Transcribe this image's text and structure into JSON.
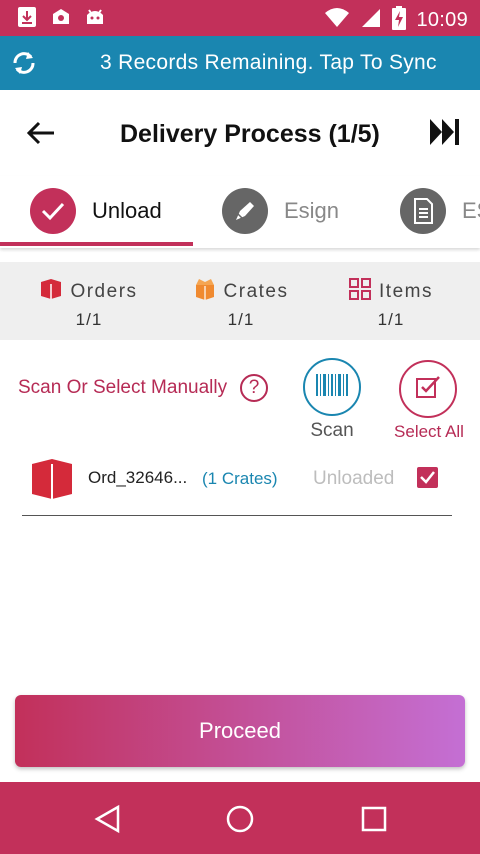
{
  "status_bar": {
    "time": "10:09",
    "left_icons": [
      "download-icon",
      "android-icon",
      "android-head-icon"
    ],
    "right_icons": [
      "wifi-icon",
      "signal-icon",
      "battery-charging-icon"
    ]
  },
  "sync": {
    "text": "3 Records Remaining. Tap To Sync",
    "icon": "sync-icon"
  },
  "header": {
    "title": "Delivery Process (1/5)",
    "back_icon": "arrow-left-icon",
    "skip_icon": "skip-next-icon"
  },
  "steps": [
    {
      "label": "Unload",
      "icon": "check-icon",
      "active": true
    },
    {
      "label": "Esign",
      "icon": "pen-icon",
      "active": false
    },
    {
      "label": "ES",
      "icon": "document-icon",
      "active": false
    }
  ],
  "summary": {
    "orders": {
      "label": "Orders",
      "value": "1/1"
    },
    "crates": {
      "label": "Crates",
      "value": "1/1"
    },
    "items": {
      "label": "Items",
      "value": "1/1"
    }
  },
  "scan_section": {
    "label": "Scan Or Select Manually",
    "help": "?",
    "scan_label": "Scan",
    "select_all_label": "Select All"
  },
  "orders": [
    {
      "id": "Ord_32646...",
      "crates": "(1 Crates)",
      "status": "Unloaded",
      "checked": true
    }
  ],
  "proceed_label": "Proceed",
  "colors": {
    "primary": "#c2305a",
    "sync_blue": "#1a86b0",
    "summary_bg": "#efefef"
  }
}
